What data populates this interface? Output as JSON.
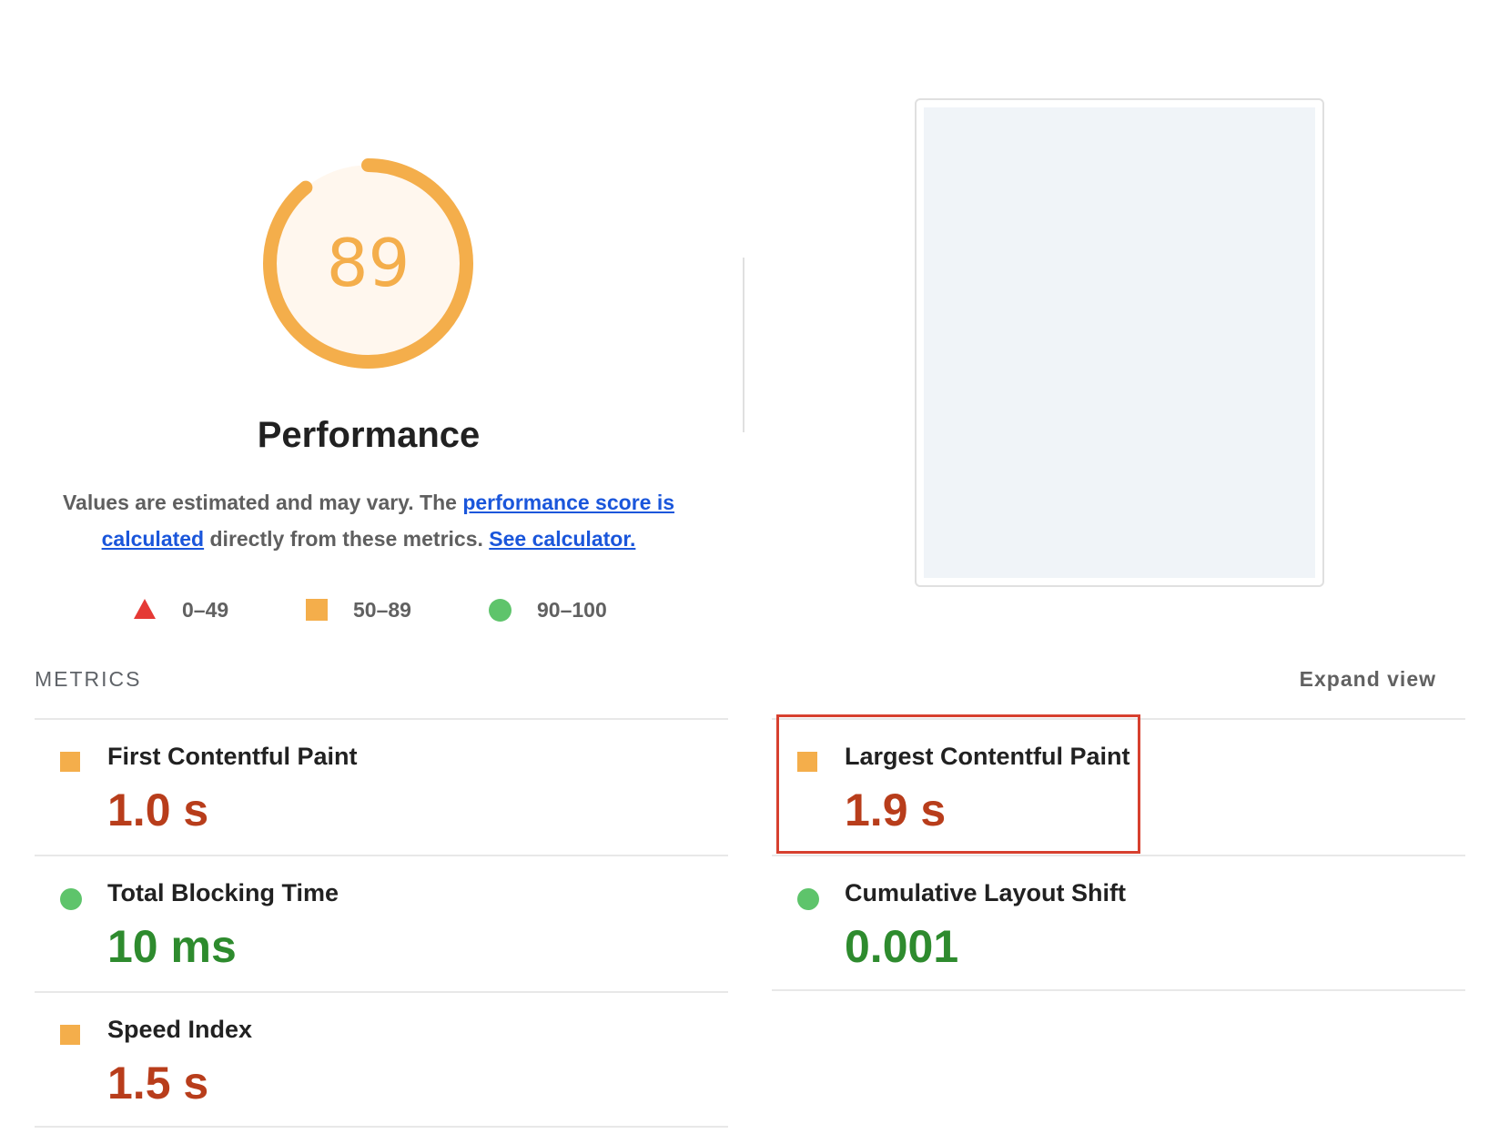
{
  "gauge": {
    "score": "89",
    "fraction": 0.89,
    "color": "#f4ae4b",
    "fill": "#fff7ee"
  },
  "title": "Performance",
  "description": {
    "part1": "Values are estimated and may vary. The ",
    "link1": "performance score is calculated",
    "part2": " directly from these metrics. ",
    "link2": "See calculator."
  },
  "legend": [
    {
      "shape": "triangle",
      "label": "0–49",
      "color": "#e53935"
    },
    {
      "shape": "square",
      "label": "50–89",
      "color": "#f4ae4b"
    },
    {
      "shape": "circle",
      "label": "90–100",
      "color": "#5ec46b"
    }
  ],
  "metrics_header": "METRICS",
  "expand_view": "Expand view",
  "metrics": {
    "fcp": {
      "name": "First Contentful Paint",
      "value": "1.0 s",
      "status": "average"
    },
    "lcp": {
      "name": "Largest Contentful Paint",
      "value": "1.9 s",
      "status": "average"
    },
    "tbt": {
      "name": "Total Blocking Time",
      "value": "10 ms",
      "status": "good"
    },
    "cls": {
      "name": "Cumulative Layout Shift",
      "value": "0.001",
      "status": "good"
    },
    "si": {
      "name": "Speed Index",
      "value": "1.5 s",
      "status": "average"
    }
  },
  "colors": {
    "accent_orange": "#f4ae4b",
    "value_orange": "#b83d1b",
    "value_green": "#2e8b2e",
    "highlight_red": "#d7402f",
    "link_blue": "#1a56db"
  }
}
